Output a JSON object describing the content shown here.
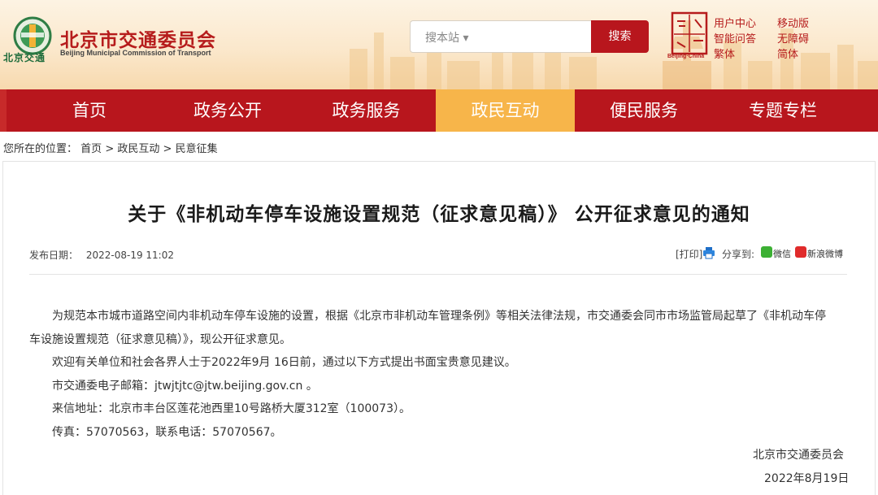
{
  "header": {
    "site_title": "北京市交通委员会",
    "site_title_en": "Beijing Municipal Commission of Transport",
    "logo_text": "北京交通",
    "search_placeholder": "搜本站 ▾",
    "search_button": "搜索",
    "capital_logo_text": "Beijing·China",
    "links": {
      "user_center": "用户中心",
      "mobile": "移动版",
      "smart_qa": "智能问答",
      "accessible": "无障碍",
      "traditional": "繁体",
      "simplified": "简体"
    }
  },
  "nav": {
    "items": [
      {
        "label": "首页"
      },
      {
        "label": "政务公开"
      },
      {
        "label": "政务服务"
      },
      {
        "label": "政民互动"
      },
      {
        "label": "便民服务"
      },
      {
        "label": "专题专栏"
      }
    ],
    "active_index": 3
  },
  "breadcrumb": {
    "prefix": "您所在的位置：",
    "items": [
      "首页",
      "政民互动",
      "民意征集"
    ],
    "separator": ">"
  },
  "article": {
    "title": "关于《非机动车停车设施设置规范（征求意见稿）》 公开征求意见的通知",
    "date_label": "发布日期：",
    "date": "2022-08-19 11:02",
    "print_label": "[打印]",
    "share_label": "分享到:",
    "share_wechat": "微信",
    "share_weibo": "新浪微博",
    "paragraphs": {
      "p1_line1": "为规范本市城市道路空间内非机动车停车设施的设置，根据《北京市非机动车管理条例》等相关法律法规，市交通委会同市市场监管局起草了《非机动车停",
      "p1_line2": "车设施设置规范（征求意见稿）》，现公开征求意见。",
      "p2": "欢迎有关单位和社会各界人士于2022年9月 16日前，通过以下方式提出书面宝贵意见建议。",
      "p3": "市交通委电子邮箱：jtwjtjtc@jtw.beijing.gov.cn 。",
      "p4": "来信地址：北京市丰台区莲花池西里10号路桥大厦312室（100073）。",
      "p5": "传真：57070563，联系电话：57070567。"
    },
    "signature_org": "北京市交通委员会",
    "signature_date": "2022年8月19日"
  },
  "colors": {
    "brand_red": "#b8161d",
    "nav_active": "#f7b54a",
    "header_bg": "#fbe8cc"
  }
}
